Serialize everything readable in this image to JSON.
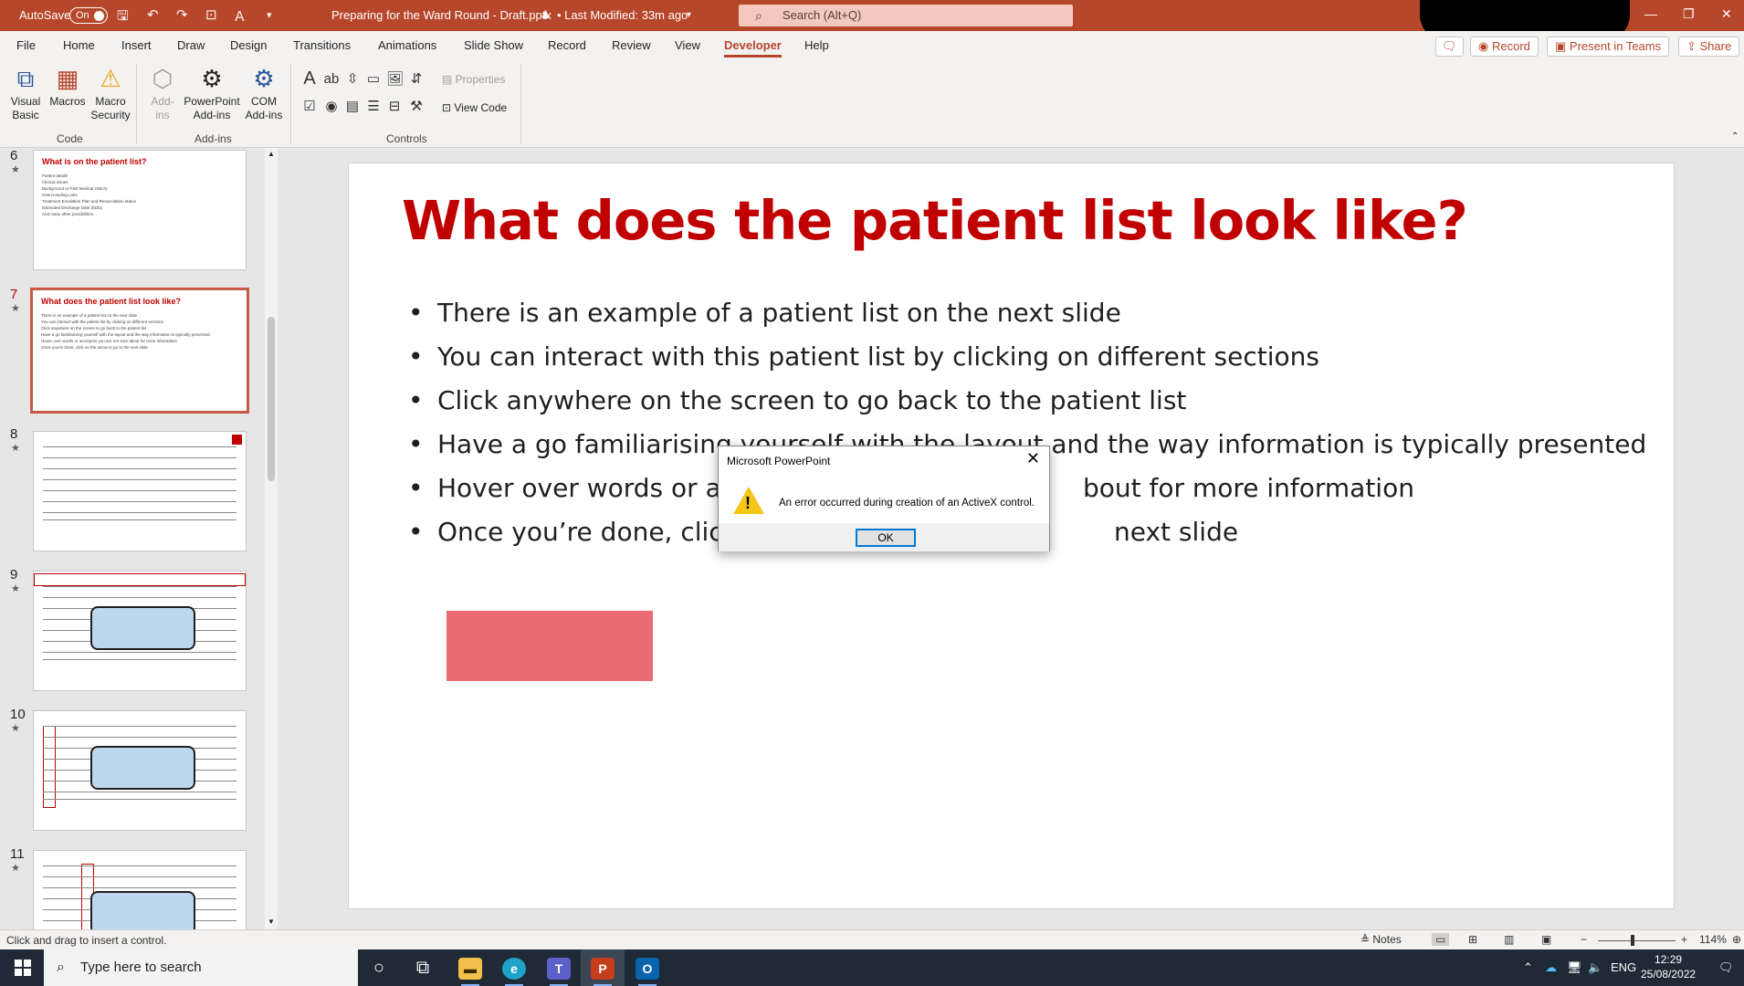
{
  "titlebar": {
    "autosave_label": "AutoSave",
    "autosave_state": "On",
    "doc_title": "Preparing for the Ward Round - Draft.pptx",
    "modified": "• Last Modified: 33m ago",
    "search_placeholder": "Search (Alt+Q)"
  },
  "tabs": [
    "File",
    "Home",
    "Insert",
    "Draw",
    "Design",
    "Transitions",
    "Animations",
    "Slide Show",
    "Record",
    "Review",
    "View",
    "Developer",
    "Help"
  ],
  "active_tab": "Developer",
  "tab_buttons": {
    "record": "Record",
    "present": "Present in Teams",
    "share": "Share"
  },
  "ribbon": {
    "code": {
      "label": "Code",
      "visual_basic": "Visual\nBasic",
      "macros": "Macros",
      "macro_security": "Macro\nSecurity"
    },
    "addins": {
      "label": "Add-ins",
      "addins": "Add-\nins",
      "ppt_addins": "PowerPoint\nAdd-ins",
      "com_addins": "COM\nAdd-ins"
    },
    "controls": {
      "label": "Controls",
      "properties": "Properties",
      "view_code": "View Code"
    }
  },
  "thumbnails": [
    {
      "num": "6",
      "title": "What is on the patient list?",
      "lines": [
        "Patient details",
        "Clinical issues",
        "Background or Past Medical History",
        "Overcrowding Labs",
        "Treatment Escalation Plan and Resuscitation status",
        "Estimated Discharge Date (EDD)",
        "And many other possibilities..."
      ]
    },
    {
      "num": "7",
      "title": "What does the patient list look like?",
      "selected": true,
      "lines": [
        "There is an example of a patient list on the next slide",
        "You can interact with the patient list by clicking on different sections",
        "Click anywhere on the screen to go back to the patient list",
        "Have a go familiarising yourself with the layout and the way information is typically presented",
        "Hover over words or acronyms you are not sure about for more information",
        "Once you're done, click on the arrow to go to the next slide"
      ]
    },
    {
      "num": "8"
    },
    {
      "num": "9"
    },
    {
      "num": "10"
    },
    {
      "num": "11"
    }
  ],
  "slide": {
    "title": "What does the patient list look like?",
    "bullets": [
      "There is an example of a patient list on the next slide",
      "You can interact with this patient list by clicking on different sections",
      "Click anywhere on the screen to go back to the patient list",
      "Have a go familiarising yourself with the layout and the way information is typically presented",
      "Hover over words or ac",
      "Once you’re done, click"
    ],
    "bullet_tails": [
      "",
      "",
      "",
      "",
      "bout for more information",
      "next slide"
    ],
    "box_color": "#eb6b73"
  },
  "dialog": {
    "title": "Microsoft PowerPoint",
    "message": "An error occurred during creation of an ActiveX control.",
    "ok": "OK"
  },
  "status": {
    "message": "Click and drag to insert a control.",
    "notes": "Notes",
    "zoom": "114%",
    "zoom_fraction": 0.45
  },
  "taskbar": {
    "search_placeholder": "Type here to search",
    "lang": "ENG",
    "time": "12:29",
    "date": "25/08/2022"
  },
  "colors": {
    "accent": "#b7472a",
    "title_red": "#c00000"
  }
}
